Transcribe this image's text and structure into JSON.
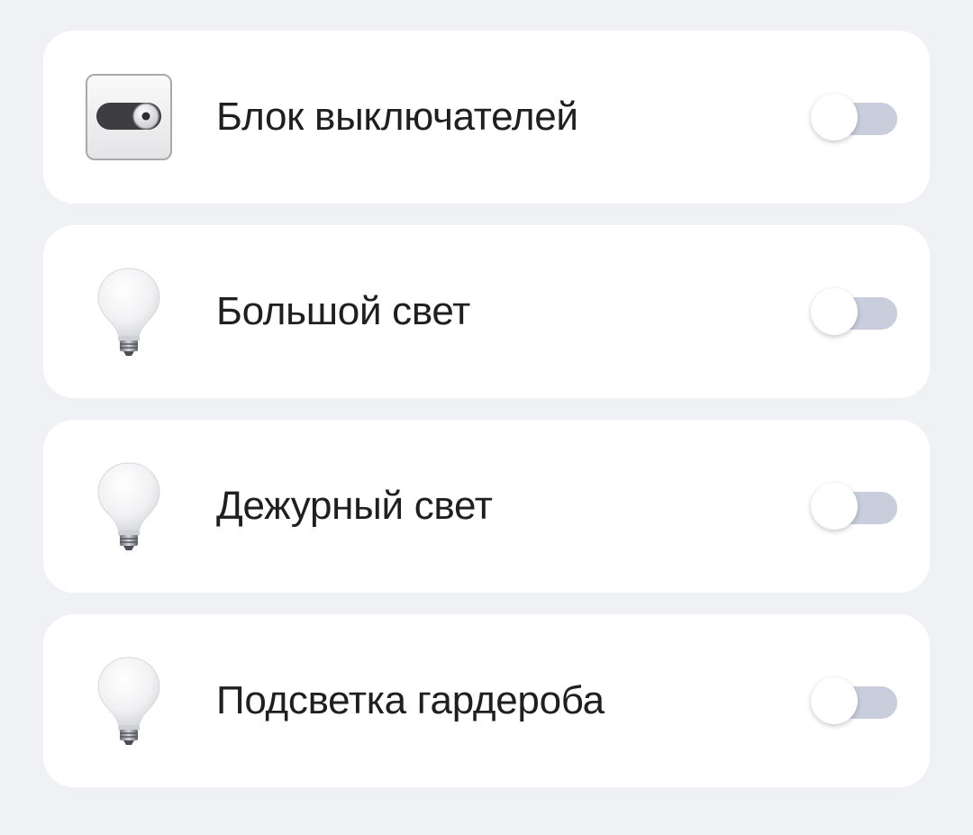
{
  "devices": [
    {
      "name": "Блок выключателей",
      "icon": "switch-block-icon",
      "on": false
    },
    {
      "name": "Большой свет",
      "icon": "light-bulb-icon",
      "on": false
    },
    {
      "name": "Дежурный свет",
      "icon": "light-bulb-icon",
      "on": false
    },
    {
      "name": "Подсветка гардероба",
      "icon": "light-bulb-icon",
      "on": false
    }
  ],
  "colors": {
    "background": "#f0f1f5",
    "card": "#ffffff",
    "toggle_track_off": "#c9cedd",
    "toggle_knob": "#ffffff",
    "text": "#1f1f21"
  }
}
